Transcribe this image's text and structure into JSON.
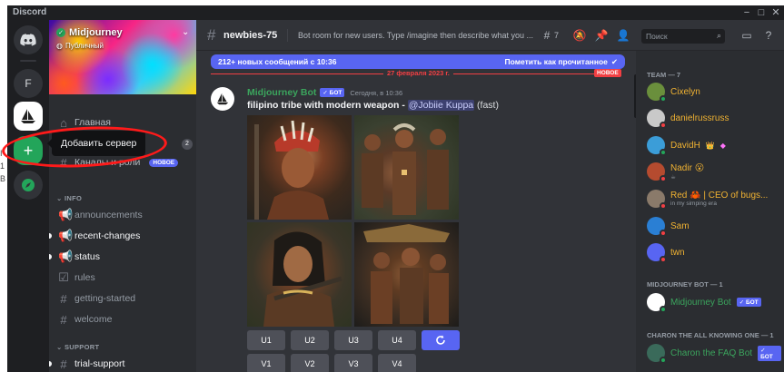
{
  "window": {
    "title": "Discord",
    "controls": [
      "−",
      "□",
      "✕"
    ]
  },
  "left_marks": [
    "I",
    "1",
    "B"
  ],
  "rail": {
    "home_icon": "discord-logo-icon",
    "servers": [
      {
        "label": "F",
        "name": "server-f"
      },
      {
        "label": "",
        "name": "server-midjourney-boat"
      }
    ],
    "add_server_icon": "+",
    "explore_icon": "compass-icon"
  },
  "tooltip": "Добавить сервер",
  "server": {
    "name": "Midjourney",
    "public_label": "Публичный",
    "home_label": "Главная",
    "count_badge": "2",
    "roles_label": "Каналы и роли",
    "roles_badge": "НОВОЕ"
  },
  "categories": {
    "info": "INFO",
    "support": "SUPPORT"
  },
  "channels": [
    {
      "label": "announcements",
      "icon": "megaphone-icon",
      "bold": false
    },
    {
      "label": "recent-changes",
      "icon": "megaphone-icon",
      "bold": true
    },
    {
      "label": "status",
      "icon": "megaphone-icon",
      "bold": true
    },
    {
      "label": "rules",
      "icon": "checkbox-icon",
      "bold": false
    },
    {
      "label": "getting-started",
      "icon": "hash-icon",
      "bold": false
    },
    {
      "label": "welcome",
      "icon": "hash-icon",
      "bold": false
    }
  ],
  "support_channel": "trial-support",
  "topbar": {
    "channel": "newbies-75",
    "topic": "Bot room for new users. Type /imagine then describe what you ...",
    "thread_count": "7",
    "search_placeholder": "Поиск"
  },
  "new_messages": {
    "text": "212+ новых сообщений с 10:36",
    "mark_read": "Пометить как прочитанное",
    "date": "27 февраля 2023 г.",
    "new_flag": "НОВОЕ"
  },
  "message": {
    "author": "Midjourney Bot",
    "bot_tag": "✓ БОТ",
    "time": "Сегодня, в 10:36",
    "prompt": "filipino tribe with modern weapon",
    "separator": " - ",
    "mention": "@Jobiie Kuppa",
    "mode": " (fast)"
  },
  "buttons": {
    "row1": [
      "U1",
      "U2",
      "U3",
      "U4"
    ],
    "row2": [
      "V1",
      "V2",
      "V3",
      "V4"
    ],
    "reroll_icon": "refresh-icon"
  },
  "members": {
    "team_header": "TEAM — 7",
    "team": [
      {
        "name": "Cixelyn",
        "color": "#f0b232",
        "avatar": "#6a8f3c",
        "status": "#23a55a",
        "sub": ""
      },
      {
        "name": "danielrussruss",
        "color": "#f0b232",
        "avatar": "#c9c9c9",
        "status": "#f23f43",
        "sub": ""
      },
      {
        "name": "DavidH",
        "color": "#f0b232",
        "avatar": "#3b9dd8",
        "status": "#23a55a",
        "sub": ""
      },
      {
        "name": "Nadir",
        "color": "#f0b232",
        "avatar": "#b54b2f",
        "status": "#f23f43",
        "sub": ""
      },
      {
        "name": "Red",
        "color": "#f0b232",
        "avatar": "#8a7a6a",
        "status": "#f23f43",
        "sub": "in my simping era"
      },
      {
        "name": "Sam",
        "color": "#f0b232",
        "avatar": "#2a7fd4",
        "status": "#f23f43",
        "sub": ""
      },
      {
        "name": "twn",
        "color": "#f0b232",
        "avatar": "#5865f2",
        "status": "#f23f43",
        "sub": ""
      }
    ],
    "red_extra": "| CEO of bugs...",
    "mj_header": "MIDJOURNEY BOT — 1",
    "mj_bot": {
      "name": "Midjourney Bot",
      "tag": "✓ БОТ"
    },
    "charon_header": "CHARON THE ALL KNOWING ONE — 1",
    "charon": {
      "name": "Charon the FAQ Bot",
      "tag": "✓ БОТ"
    }
  }
}
